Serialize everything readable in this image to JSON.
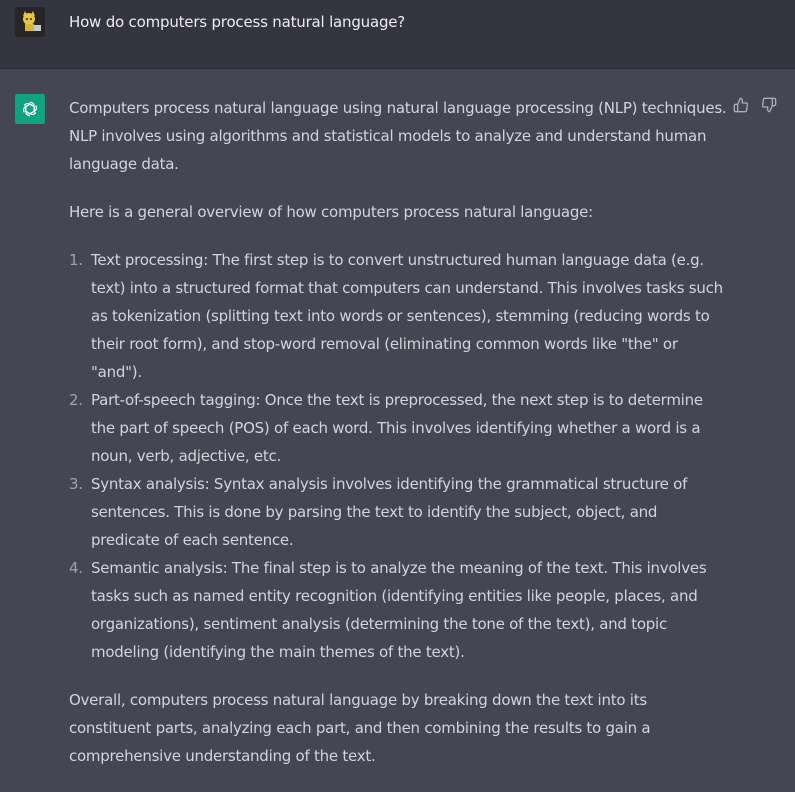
{
  "user_message": {
    "text": "How do computers process natural language?"
  },
  "assistant_message": {
    "intro": "Computers process natural language using natural language processing (NLP) techniques. NLP involves using algorithms and statistical models to analyze and understand human language data.",
    "overview": "Here is a general overview of how computers process natural language:",
    "steps": [
      {
        "num": "1.",
        "text": "Text processing: The first step is to convert unstructured human language data (e.g. text) into a structured format that computers can understand. This involves tasks such as tokenization (splitting text into words or sentences), stemming (reducing words to their root form), and stop-word removal (eliminating common words like \"the\" or \"and\")."
      },
      {
        "num": "2.",
        "text": "Part-of-speech tagging: Once the text is preprocessed, the next step is to determine the part of speech (POS) of each word. This involves identifying whether a word is a noun, verb, adjective, etc."
      },
      {
        "num": "3.",
        "text": "Syntax analysis: Syntax analysis involves identifying the grammatical structure of sentences. This is done by parsing the text to identify the subject, object, and predicate of each sentence."
      },
      {
        "num": "4.",
        "text": "Semantic analysis: The final step is to analyze the meaning of the text. This involves tasks such as named entity recognition (identifying entities like people, places, and organizations), sentiment analysis (determining the tone of the text), and topic modeling (identifying the main themes of the text)."
      }
    ],
    "conclusion": "Overall, computers process natural language by breaking down the text into its constituent parts, analyzing each part, and then combining the results to gain a comprehensive understanding of the text."
  },
  "icons": {
    "user_avatar": "user-avatar-icon",
    "assistant_avatar": "openai-logo-icon",
    "thumbs_up": "thumbs-up-icon",
    "thumbs_down": "thumbs-down-icon"
  },
  "colors": {
    "user_bg": "#343541",
    "assistant_bg": "#444654",
    "accent": "#10a37f",
    "text": "#d1d5db"
  }
}
